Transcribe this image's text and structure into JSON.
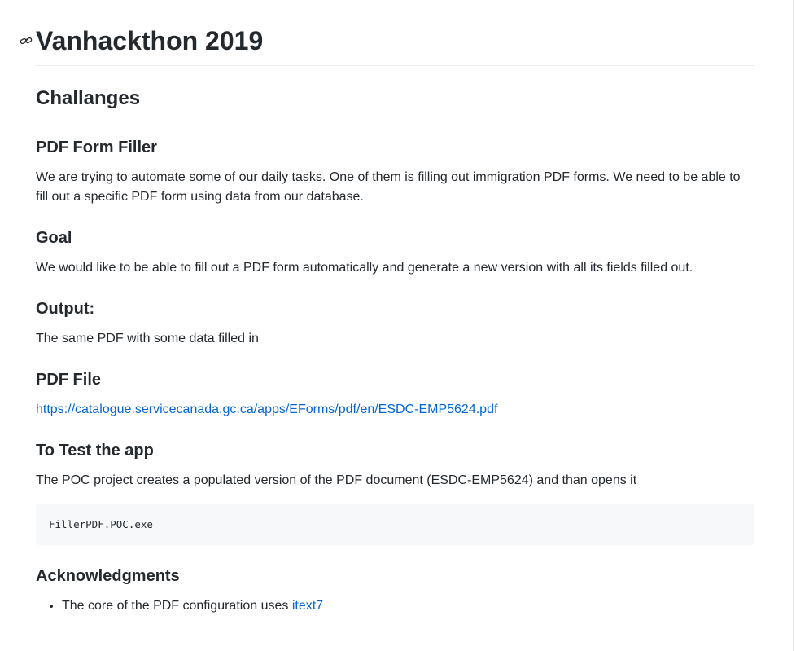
{
  "title": "Vanhackthon 2019",
  "challenges_heading": "Challanges",
  "sections": {
    "pdf_form_filler": {
      "heading": "PDF Form Filler",
      "text": "We are trying to automate some of our daily tasks. One of them is filling out immigration PDF forms. We need to be able to fill out a specific PDF form using data from our database."
    },
    "goal": {
      "heading": "Goal",
      "text": "We would like to be able to fill out a PDF form automatically and generate a new version with all its fields filled out."
    },
    "output": {
      "heading": "Output:",
      "text": "The same PDF with some data filled in"
    },
    "pdf_file": {
      "heading": "PDF File",
      "link": "https://catalogue.servicecanada.gc.ca/apps/EForms/pdf/en/ESDC-EMP5624.pdf"
    },
    "test_app": {
      "heading": "To Test the app",
      "text": "The POC project creates a populated version of the PDF document (ESDC-EMP5624) and than opens it",
      "code": "FillerPDF.POC.exe"
    },
    "acknowledgments": {
      "heading": "Acknowledgments",
      "item_text": "The core of the PDF configuration uses ",
      "item_link": "itext7"
    }
  },
  "icons": {
    "anchor": "link-icon"
  },
  "colors": {
    "text": "#24292e",
    "link": "#0366d6",
    "code_bg": "#f6f8fa",
    "border": "#eaecef"
  }
}
